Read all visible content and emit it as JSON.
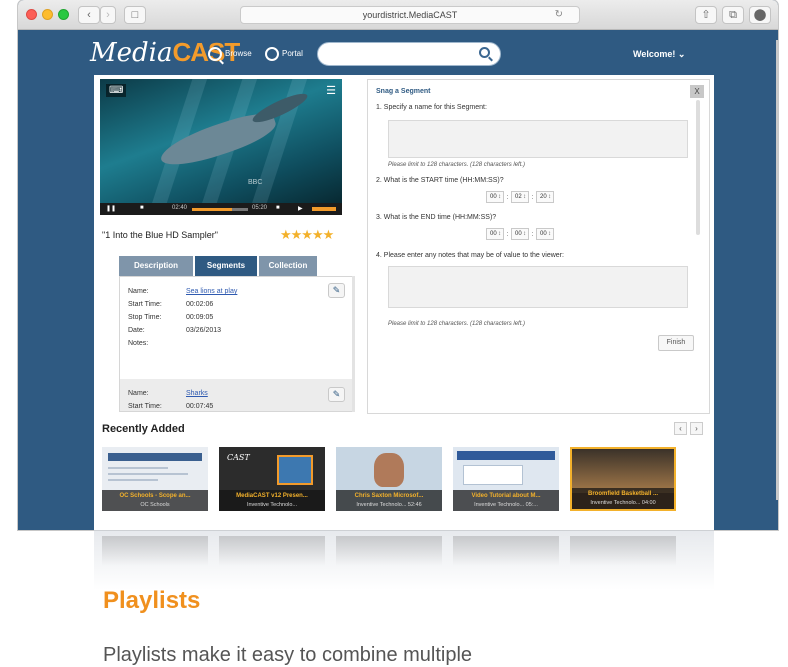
{
  "browser": {
    "address": "yourdistrict.MediaCAST",
    "back": "‹",
    "forward": "›",
    "sidebar": "□",
    "reload": "↻",
    "share": "⇧",
    "tabs": "⧉",
    "extension": "⬤"
  },
  "header": {
    "logo_script": "Media",
    "logo_bold": "CAST",
    "browse_label": "Browse",
    "portal_label": "Portal",
    "search_placeholder": "",
    "welcome": "Welcome! ⌄"
  },
  "player": {
    "top_left": "⌨",
    "top_right": "☰",
    "watermark": "BBC",
    "time_elapsed": "02:40",
    "time_total": "05:20",
    "progress": 0.7,
    "volume": 0.8
  },
  "video": {
    "title": "\"1 Into the Blue HD Sampler\"",
    "rating": 5,
    "stars": "★★★★★"
  },
  "tabs": [
    "Description",
    "Segments",
    "Collection"
  ],
  "segments": [
    {
      "name_label": "Name:",
      "name": "Sea lions at play",
      "start_label": "Start Time:",
      "start": "00:02:06",
      "stop_label": "Stop Time:",
      "stop": "00:09:05",
      "date_label": "Date:",
      "date": "03/26/2013",
      "notes_label": "Notes:"
    },
    {
      "name_label": "Name:",
      "name": "Sharks",
      "start_label": "Start Time:",
      "start": "00:07:45"
    }
  ],
  "snag": {
    "title": "Snag a Segment",
    "close": "X",
    "q1": "1.  Specify a name for this Segment:",
    "hint1": "Please limit to 128 characters. (128 characters left.)",
    "q2": "2.  What is the START time (HH:MM:SS)?",
    "start": [
      "00",
      "02",
      "20"
    ],
    "q3": "3.  What is the END time (HH:MM:SS)?",
    "end": [
      "00",
      "00",
      "00"
    ],
    "q4": "4.  Please enter any notes that may be of value to the viewer:",
    "hint2": "Please limit to 128 characters. (128 characters left.)",
    "finish": "Finish"
  },
  "recent": {
    "title": "Recently Added",
    "prev": "‹",
    "next": "›",
    "items": [
      {
        "title": "OC Schools - Scope an...",
        "sub": "OC Schools"
      },
      {
        "title": "MediaCAST v12 Presen...",
        "sub": "Inventive Technolo..."
      },
      {
        "title": "Chris Saxton Microsof...",
        "sub": "Inventive Technolo... 52:46"
      },
      {
        "title": "Video Tutorial about M...",
        "sub": "Inventive Technolo... 05:..."
      },
      {
        "title": "Broomfield Basketball ...",
        "sub": "Inventive Technolo... 04:00"
      }
    ]
  },
  "marketing": {
    "heading": "Playlists",
    "body": "Playlists make it easy to combine multiple"
  }
}
